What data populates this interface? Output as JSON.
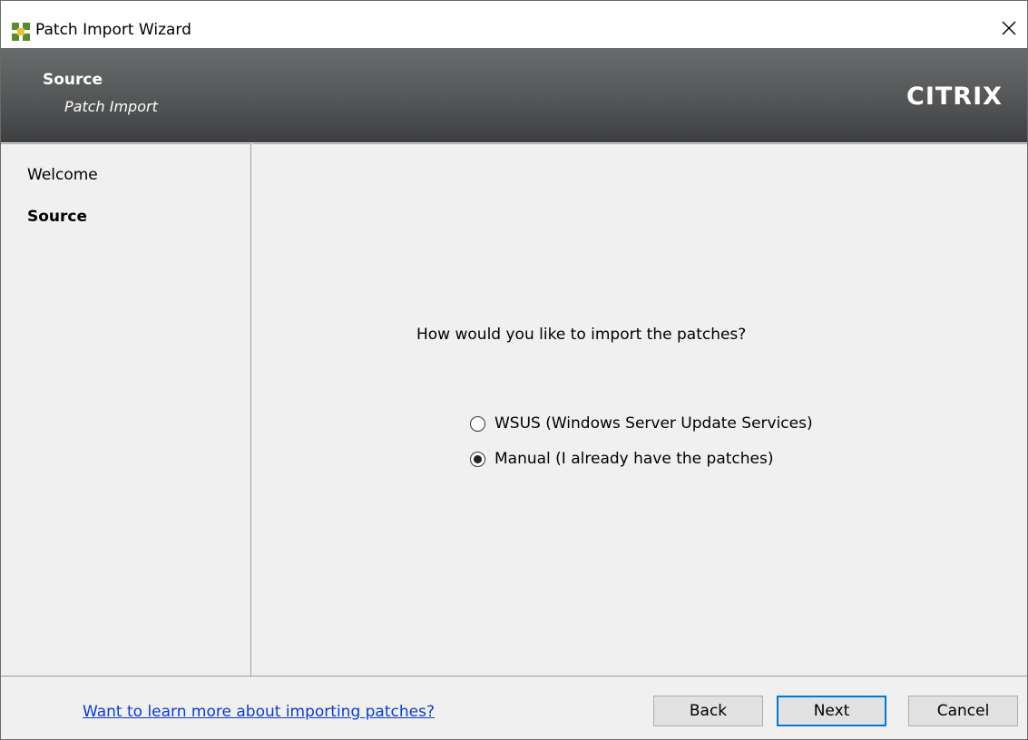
{
  "window": {
    "title": "Patch Import Wizard",
    "close_glyph": "✕"
  },
  "banner": {
    "title": "Source",
    "subtitle": "Patch Import",
    "logo": "CİTRİX"
  },
  "nav": {
    "items": [
      {
        "label": "Welcome",
        "active": false
      },
      {
        "label": "Source",
        "active": true
      }
    ]
  },
  "main": {
    "question": "How would you like to import the patches?",
    "options": [
      {
        "label": "WSUS (Windows Server Update Services)",
        "checked": false
      },
      {
        "label": "Manual (I already have the patches)",
        "checked": true
      }
    ]
  },
  "footer": {
    "help_link": "Want to learn more about importing patches?",
    "back_label": "Back",
    "next_label": "Next",
    "cancel_label": "Cancel"
  },
  "colors": {
    "link": "#0b3bd0",
    "focus_border": "#0078d7",
    "banner_dark": "#3e3f41",
    "app_icon_green": "#5a8a2f",
    "app_icon_yellow": "#e2c23a"
  },
  "icons": {
    "app": "citrix-patch-wizard-icon",
    "close": "close-icon"
  }
}
